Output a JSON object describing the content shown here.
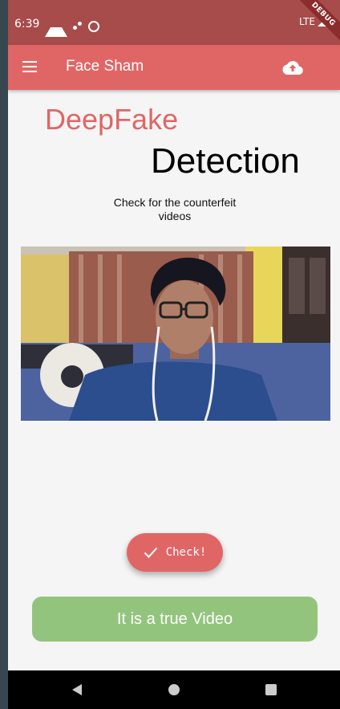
{
  "status_bar": {
    "time": "6:39",
    "network": "LTE",
    "debug_label": "DEBUG",
    "icons": [
      "drive-icon",
      "dots-icon",
      "circle-icon",
      "signal-icon",
      "battery-icon"
    ]
  },
  "app_bar": {
    "title": "Face Sham",
    "menu_icon": "menu-icon",
    "action_icon": "cloud-upload-icon"
  },
  "heading": {
    "line1": "DeepFake",
    "line2": "Detection"
  },
  "subtitle": "Check for the counterfeit videos",
  "video": {
    "icon": "video-preview"
  },
  "check_button": {
    "label": "Check!",
    "icon": "check-icon"
  },
  "result": {
    "text": "It is a true Video"
  },
  "colors": {
    "status_bar": "#a74b4b",
    "primary": "#e06666",
    "result": "#93c47d",
    "background": "#f5f5f5"
  }
}
